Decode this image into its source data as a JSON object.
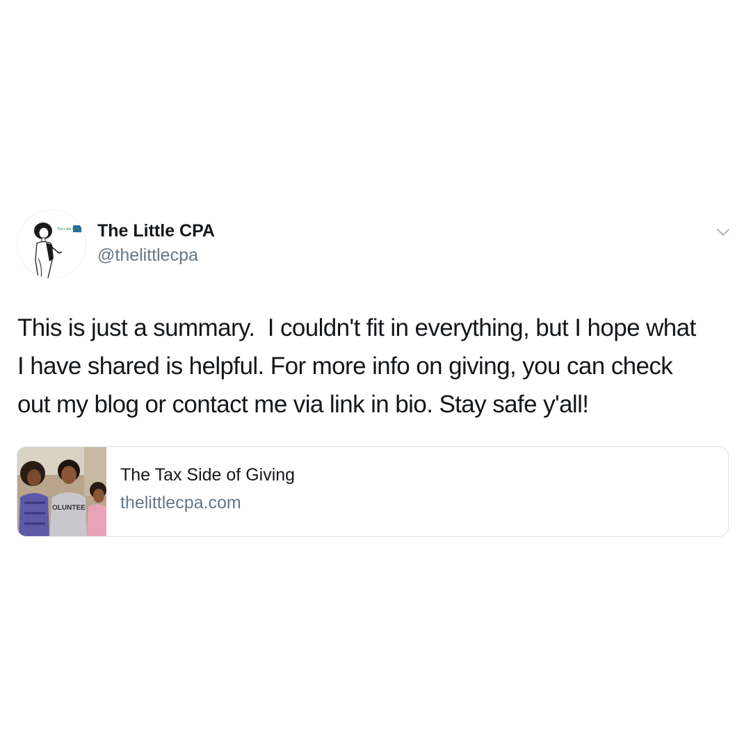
{
  "author": {
    "display_name": "The Little CPA",
    "handle": "@thelittlecpa",
    "avatar_logo_text": "The Little CPA"
  },
  "tweet": {
    "text": "This is just a summary.  I couldn't fit in everything, but I hope what\nI have shared is helpful. For more info on giving, you can check\nout my blog or contact me via link in bio. Stay safe y'all!"
  },
  "link_card": {
    "title": "The Tax Side of Giving",
    "domain": "thelittlecpa.com",
    "thumbnail_shirt_text": "OLUNTEE"
  },
  "icons": {
    "menu": "chevron-down-icon"
  },
  "colors": {
    "primary_text": "#14171a",
    "secondary_text": "#657786",
    "card_border": "#dfe3e8",
    "background": "#ffffff"
  }
}
